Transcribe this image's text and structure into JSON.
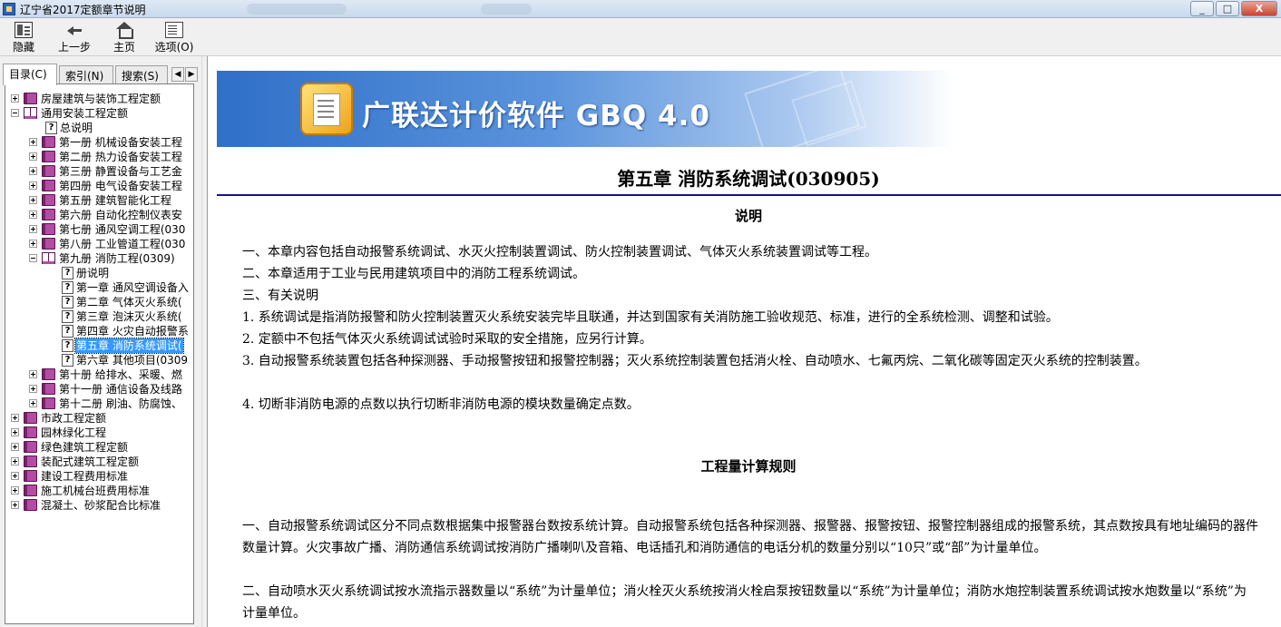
{
  "window": {
    "title": "辽宁省2017定额章节说明",
    "minimize": "_",
    "maximize": "□",
    "close": "X"
  },
  "toolbar": {
    "hide": "隐藏",
    "back": "上一步",
    "home": "主页",
    "options": "选项(O)"
  },
  "tabs": {
    "contents": "目录(C)",
    "index": "索引(N)",
    "search": "搜索(S)",
    "prev": "◀",
    "next": "▶"
  },
  "tree": [
    "房屋建筑与装饰工程定额",
    "通用安装工程定额",
    "总说明",
    "第一册 机械设备安装工程",
    "第二册 热力设备安装工程",
    "第三册 静置设备与工艺金",
    "第四册 电气设备安装工程",
    "第五册 建筑智能化工程",
    "第六册 自动化控制仪表安",
    "第七册 通风空调工程(030",
    "第八册 工业管道工程(030",
    "第九册 消防工程(0309)",
    "册说明",
    "第一章 通风空调设备入",
    "第二章 气体灭火系统(",
    "第三章 泡沫灭火系统(",
    "第四章 火灾自动报警系",
    "第五章 消防系统调试(",
    "第六章 其他项目(0309",
    "第十册 给排水、采暖、燃",
    "第十一册 通信设备及线路",
    "第十二册 刷油、防腐蚀、",
    "市政工程定额",
    "园林绿化工程",
    "绿色建筑工程定额",
    "装配式建筑工程定额",
    "建设工程费用标准",
    "施工机械台班费用标准",
    "混凝土、砂浆配合比标准"
  ],
  "content": {
    "banner": "广联达计价软件 GBQ 4.0",
    "chapter_title": "第五章 消防系统调试(030905)",
    "section1": "说明",
    "p1": "一、本章内容包括自动报警系统调试、水灭火控制装置调试、防火控制装置调试、气体灭火系统装置调试等工程。",
    "p2": "二、本章适用于工业与民用建筑项目中的消防工程系统调试。",
    "p3": "三、有关说明",
    "p4": "1. 系统调试是指消防报警和防火控制装置灭火系统安装完毕且联通，并达到国家有关消防施工验收规范、标准，进行的全系统检测、调整和试验。",
    "p5": "2. 定额中不包括气体灭火系统调试试验时采取的安全措施，应另行计算。",
    "p6": "3. 自动报警系统装置包括各种探测器、手动报警按钮和报警控制器；灭火系统控制装置包括消火栓、自动喷水、七氟丙烷、二氧化碳等固定灭火系统的控制装置。",
    "p7": "4. 切断非消防电源的点数以执行切断非消防电源的模块数量确定点数。",
    "section2": "工程量计算规则",
    "r1": "一、自动报警系统调试区分不同点数根据集中报警器台数按系统计算。自动报警系统包括各种探测器、报警器、报警按钮、报警控制器组成的报警系统，其点数按具有地址编码的器件数量计算。火灾事故广播、消防通信系统调试按消防广播喇叭及音箱、电话插孔和消防通信的电话分机的数量分别以“10只”或“部”为计量单位。",
    "r2": "二、自动喷水灭火系统调试按水流指示器数量以“系统”为计量单位；消火栓灭火系统按消火栓启泵按钮数量以“系统”为计量单位；消防水炮控制装置系统调试按水炮数量以“系统”为计量单位。"
  }
}
